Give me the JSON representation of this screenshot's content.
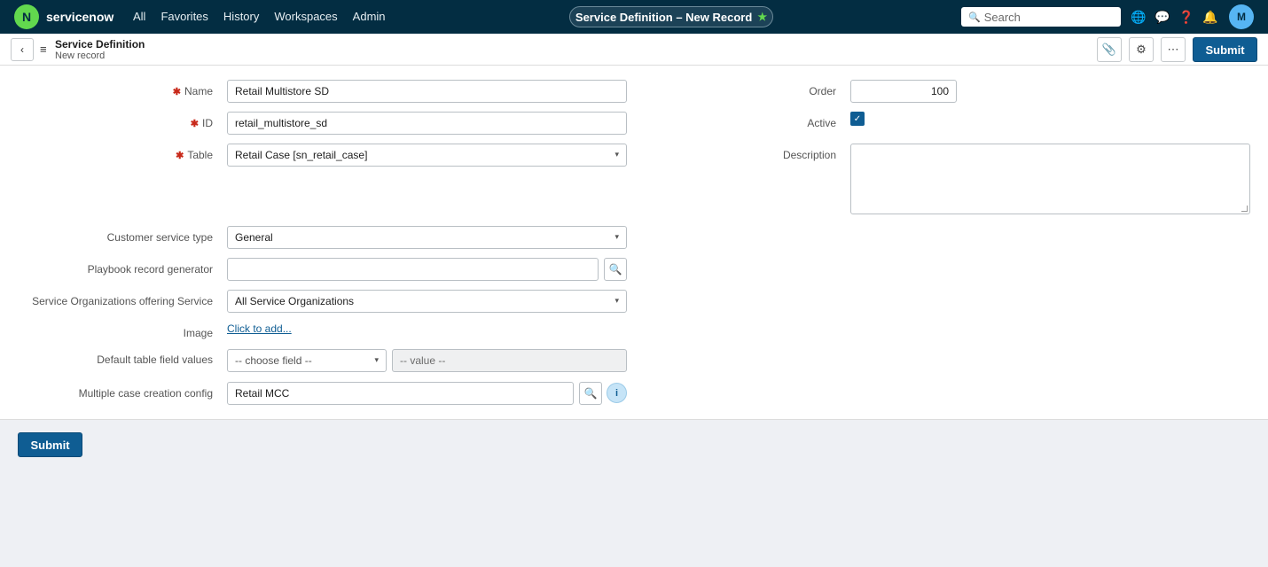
{
  "topnav": {
    "logo_letter": "N",
    "brand": "servicenow",
    "menu": [
      "All",
      "Favorites",
      "History",
      "Workspaces",
      "Admin"
    ],
    "record_pill": "Service Definition – New Record",
    "star": "★",
    "search_icon": "🔍",
    "search_placeholder": "Search",
    "icons": {
      "globe": "🌐",
      "chat": "💬",
      "help": "❓",
      "bell": "🔔"
    },
    "avatar": "M"
  },
  "header": {
    "back": "‹",
    "menu": "≡",
    "title": "Service Definition",
    "subtitle": "New record",
    "attach": "📎",
    "settings": "⚙",
    "more": "⋯",
    "submit": "Submit"
  },
  "form": {
    "name": {
      "label": "Name",
      "required": "✱",
      "value": "Retail Multistore SD"
    },
    "id": {
      "label": "ID",
      "required": "✱",
      "value": "retail_multistore_sd"
    },
    "table": {
      "label": "Table",
      "required": "✱",
      "value": "Retail Case [sn_retail_case]"
    },
    "customer_service_type": {
      "label": "Customer service type",
      "value": "General"
    },
    "playbook": {
      "label": "Playbook record generator",
      "value": "",
      "lookup": "🔍"
    },
    "service_orgs": {
      "label": "Service Organizations offering Service",
      "value": "All Service Organizations"
    },
    "image": {
      "label": "Image",
      "link": "Click to add..."
    },
    "default_values": {
      "label": "Default table field values",
      "choose": "-- choose field --",
      "value": "-- value --"
    },
    "mcc": {
      "label": "Multiple case creation config",
      "value": "Retail MCC",
      "lookup": "🔍",
      "info": "i"
    },
    "order": {
      "label": "Order",
      "value": "100"
    },
    "active": {
      "label": "Active",
      "check": "✓"
    },
    "description": {
      "label": "Description",
      "value": ""
    }
  },
  "footer": {
    "submit": "Submit"
  },
  "colors": {
    "nav_bg": "#032d42",
    "accent": "#0f5d93",
    "logo": "#62d84e",
    "required": "#c8291a"
  }
}
